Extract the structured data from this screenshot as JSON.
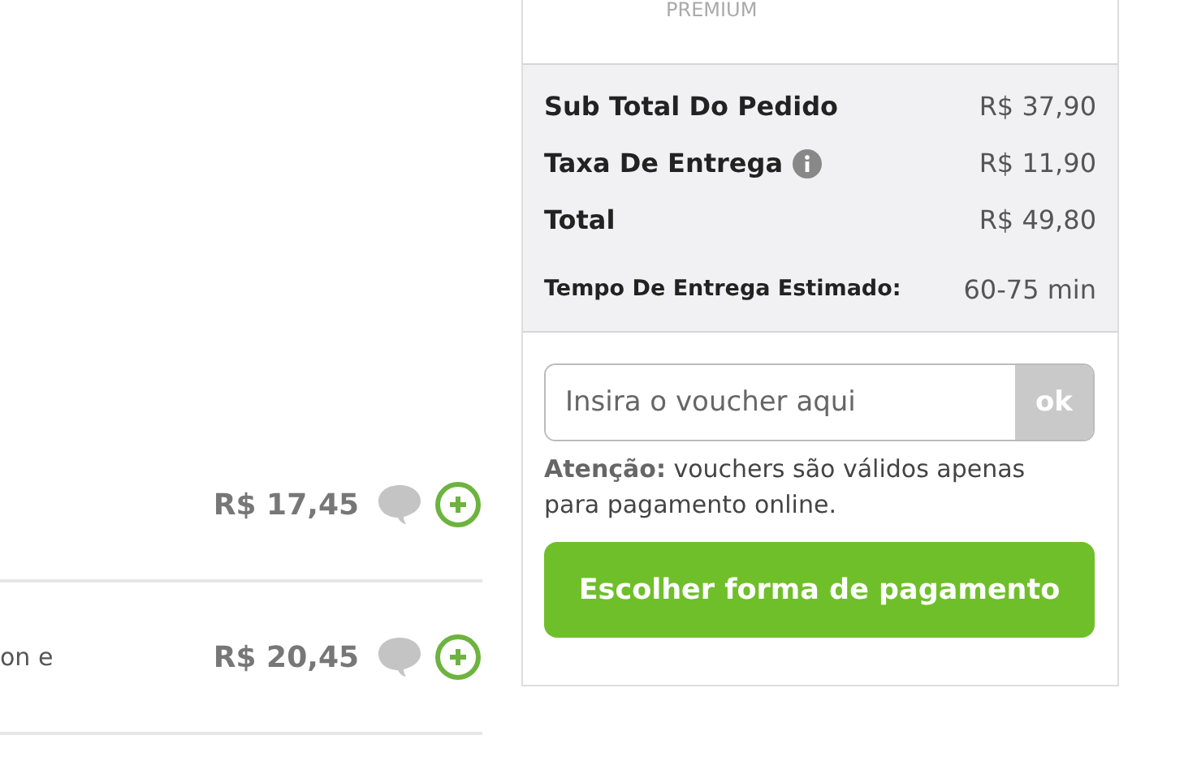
{
  "menu_items": [
    {
      "price": "R$ 17,45"
    },
    {
      "description": "on e",
      "price": "R$ 20,45"
    }
  ],
  "order_panel": {
    "badge": "PREMIUM",
    "summary": [
      {
        "label": "Sub Total Do Pedido",
        "value": "R$ 37,90",
        "kind": "line",
        "info": false
      },
      {
        "label": "Taxa De Entrega",
        "value": "R$ 11,90",
        "kind": "line",
        "info": true
      },
      {
        "label": "Total",
        "value": "R$ 49,80",
        "kind": "line",
        "info": false
      },
      {
        "label": "Tempo De Entrega Estimado:",
        "value": "60-75 min",
        "kind": "eta",
        "info": false
      }
    ],
    "voucher": {
      "placeholder": "Insira o voucher aqui",
      "button": "ok"
    },
    "note": "**Atenção:** vouchers são válidos apenas para pagamento online.",
    "pay_button": "Escolher forma de pagamento"
  }
}
